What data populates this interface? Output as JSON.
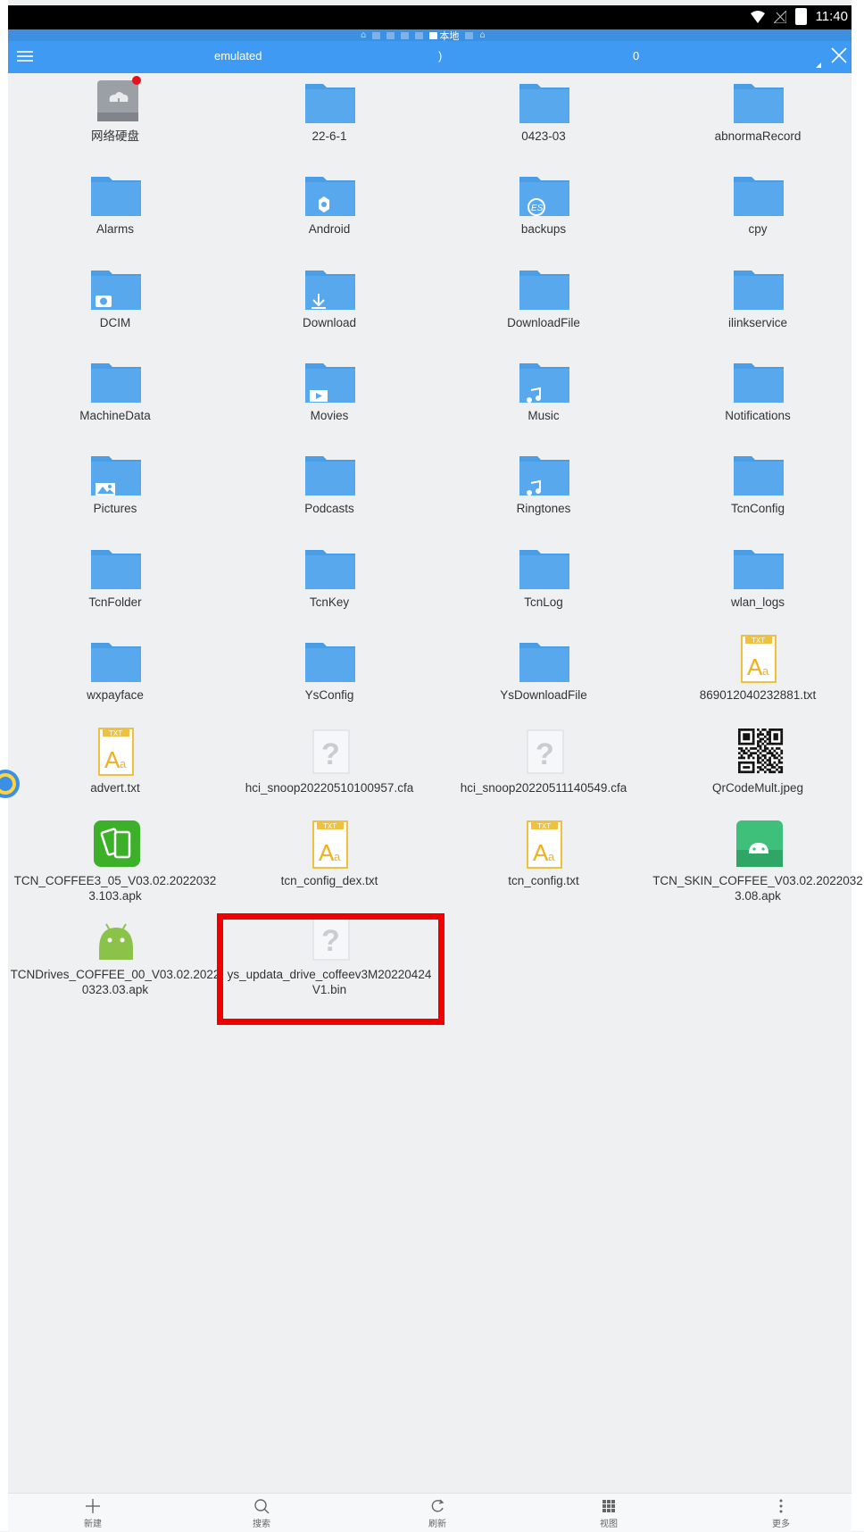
{
  "status_bar": {
    "time": "11:40"
  },
  "breadcrumb": {
    "current": "本地"
  },
  "toolbar": {
    "path": "emulated",
    "mid": ")",
    "count": "0"
  },
  "files": [
    {
      "name": "网络硬盘",
      "type": "netdisk"
    },
    {
      "name": "22-6-1",
      "type": "folder"
    },
    {
      "name": "0423-03",
      "type": "folder"
    },
    {
      "name": "abnormaRecord",
      "type": "folder"
    },
    {
      "name": "Alarms",
      "type": "folder"
    },
    {
      "name": "Android",
      "type": "folder-android"
    },
    {
      "name": "backups",
      "type": "folder-es"
    },
    {
      "name": "cpy",
      "type": "folder"
    },
    {
      "name": "DCIM",
      "type": "folder-camera"
    },
    {
      "name": "Download",
      "type": "folder-download"
    },
    {
      "name": "DownloadFile",
      "type": "folder"
    },
    {
      "name": "ilinkservice",
      "type": "folder"
    },
    {
      "name": "MachineData",
      "type": "folder"
    },
    {
      "name": "Movies",
      "type": "folder-movies"
    },
    {
      "name": "Music",
      "type": "folder-music"
    },
    {
      "name": "Notifications",
      "type": "folder"
    },
    {
      "name": "Pictures",
      "type": "folder-pictures"
    },
    {
      "name": "Podcasts",
      "type": "folder"
    },
    {
      "name": "Ringtones",
      "type": "folder-music"
    },
    {
      "name": "TcnConfig",
      "type": "folder"
    },
    {
      "name": "TcnFolder",
      "type": "folder"
    },
    {
      "name": "TcnKey",
      "type": "folder"
    },
    {
      "name": "TcnLog",
      "type": "folder"
    },
    {
      "name": "wlan_logs",
      "type": "folder"
    },
    {
      "name": "wxpayface",
      "type": "folder"
    },
    {
      "name": "YsConfig",
      "type": "folder"
    },
    {
      "name": "YsDownloadFile",
      "type": "folder"
    },
    {
      "name": "869012040232881.txt",
      "type": "txt"
    },
    {
      "name": "advert.txt",
      "type": "txt"
    },
    {
      "name": "hci_snoop20220510100957.cfa",
      "type": "unknown"
    },
    {
      "name": "hci_snoop20220511140549.cfa",
      "type": "unknown"
    },
    {
      "name": "QrCodeMult.jpeg",
      "type": "qr"
    },
    {
      "name": "TCN_COFFEE3_05_V03.02.20220323.103.apk",
      "type": "apk-green"
    },
    {
      "name": "tcn_config_dex.txt",
      "type": "txt"
    },
    {
      "name": "tcn_config.txt",
      "type": "txt"
    },
    {
      "name": "TCN_SKIN_COFFEE_V03.02.20220323.08.apk",
      "type": "apk-android-dark"
    },
    {
      "name": "TCNDrives_COFFEE_00_V03.02.20220323.03.apk",
      "type": "apk-android"
    },
    {
      "name": "ys_updata_drive_coffeev3M20220424V1.bin",
      "type": "unknown"
    }
  ],
  "bottom_bar": [
    {
      "label": "新建",
      "icon": "plus-icon"
    },
    {
      "label": "搜索",
      "icon": "search-icon"
    },
    {
      "label": "刷新",
      "icon": "refresh-icon"
    },
    {
      "label": "视图",
      "icon": "grid-view-icon"
    },
    {
      "label": "更多",
      "icon": "more-icon"
    }
  ],
  "colors": {
    "toolbar": "#3e9af2",
    "folder": "#4a9ee8",
    "highlight": "#f20000"
  }
}
